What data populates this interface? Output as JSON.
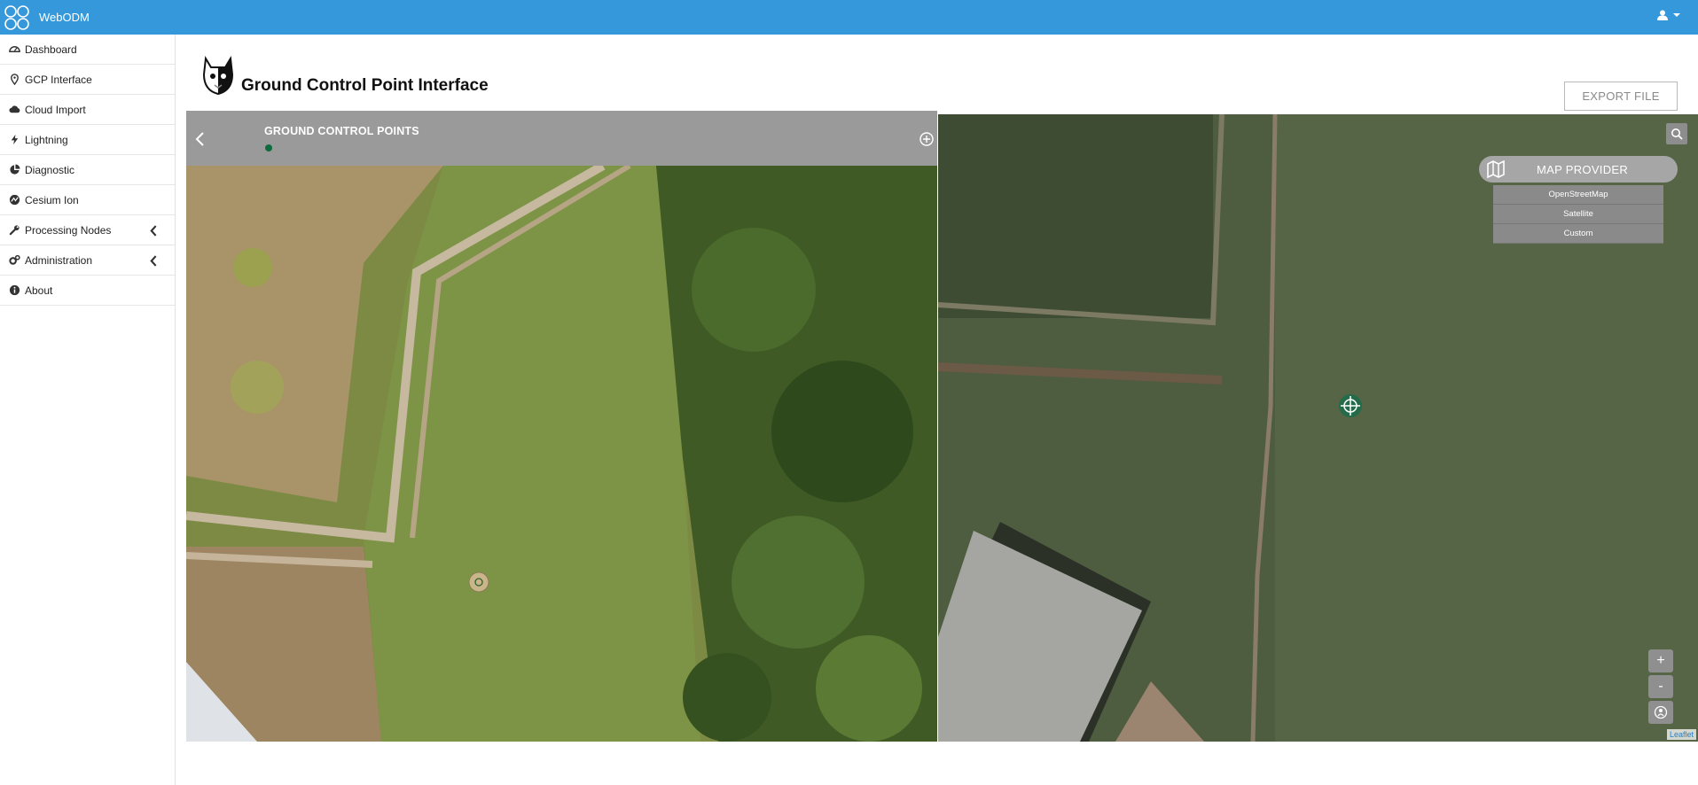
{
  "app": {
    "name": "WebODM"
  },
  "nav": {
    "items": [
      {
        "label": "Dashboard",
        "icon": "dashboard-icon"
      },
      {
        "label": "GCP Interface",
        "icon": "map-marker-icon"
      },
      {
        "label": "Cloud Import",
        "icon": "cloud-icon"
      },
      {
        "label": "Lightning",
        "icon": "lightning-icon"
      },
      {
        "label": "Diagnostic",
        "icon": "pie-chart-icon"
      },
      {
        "label": "Cesium Ion",
        "icon": "cesium-icon"
      },
      {
        "label": "Processing Nodes",
        "icon": "wrench-icon",
        "expandable": true
      },
      {
        "label": "Administration",
        "icon": "gears-icon",
        "expandable": true
      },
      {
        "label": "About",
        "icon": "info-icon"
      }
    ]
  },
  "page": {
    "title": "Ground Control Point Interface"
  },
  "toolbar": {
    "export_label": "EXPORT FILE"
  },
  "gcp_panel": {
    "title": "GROUND CONTROL POINTS",
    "point_color": "#0e6b3f"
  },
  "map": {
    "provider_label": "MAP PROVIDER",
    "providers": [
      "OpenStreetMap",
      "Satellite",
      "Custom"
    ],
    "zoom_in": "+",
    "zoom_out": "-",
    "attribution": "Leaflet"
  },
  "colors": {
    "topbar": "#3498db",
    "panel_header": "#9a9a9a"
  }
}
